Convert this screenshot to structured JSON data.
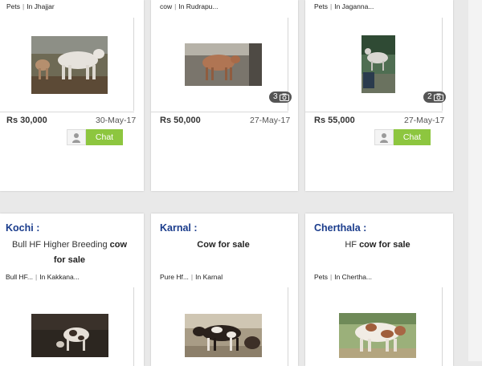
{
  "cards": [
    {
      "meta_category": "Pets",
      "meta_location": "In Jhajjar",
      "price": "Rs 30,000",
      "date": "30-May-17",
      "chat_label": "Chat Now"
    },
    {
      "meta_category": "cow",
      "meta_location": "In Rudrapu...",
      "price": "Rs 50,000",
      "date": "27-May-17",
      "photo_count": "3"
    },
    {
      "meta_category": "Pets",
      "meta_location": "In Jaganna...",
      "price": "Rs 55,000",
      "date": "27-May-17",
      "photo_count": "2",
      "chat_label": "Chat Now"
    },
    {
      "city": "Kochi :",
      "title_prefix": "Bull HF Higher Breeding",
      "title_highlight": "cow",
      "title_suffix": "for sale",
      "meta_category": "Bull HF...",
      "meta_location": "In Kakkana..."
    },
    {
      "city": "Karnal :",
      "title_highlight": "Cow",
      "title_suffix": "for sale",
      "meta_category": "Pure Hf...",
      "meta_location": "In Karnal"
    },
    {
      "city": "Cherthala :",
      "title_prefix": "HF",
      "title_highlight": "cow",
      "title_suffix": "for sale",
      "meta_category": "Pets",
      "meta_location": "In Chertha..."
    }
  ],
  "icons": {
    "avatar": "user-avatar-icon",
    "photo_count": "camera-icon"
  },
  "colors": {
    "chat_button": "#8dc63f",
    "city": "#1a3c8c",
    "background": "#e9e9e9"
  }
}
